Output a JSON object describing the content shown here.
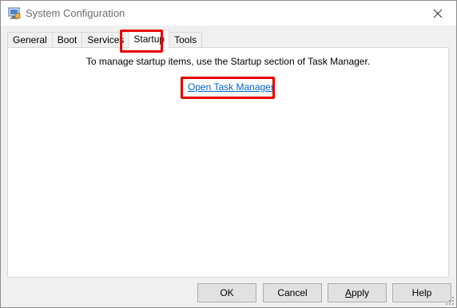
{
  "window": {
    "title": "System Configuration",
    "app_icon": "msconfig-icon",
    "close_icon": "close-icon"
  },
  "tabs": [
    {
      "label": "General"
    },
    {
      "label": "Boot"
    },
    {
      "label": "Services"
    },
    {
      "label": "Startup",
      "active": true
    },
    {
      "label": "Tools"
    }
  ],
  "panel": {
    "info": "To manage startup items, use the Startup section of Task Manager.",
    "link": "Open Task Manager"
  },
  "buttons": {
    "ok": "OK",
    "cancel": "Cancel",
    "apply": "Apply",
    "help": "Help"
  },
  "colors": {
    "highlight": "#e50000",
    "link": "#0066cc"
  }
}
